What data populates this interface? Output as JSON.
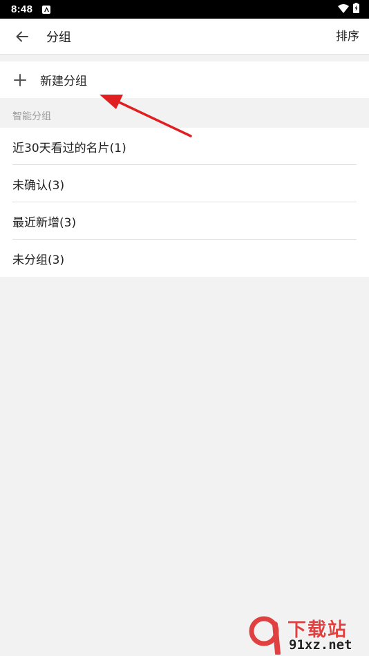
{
  "status_bar": {
    "time": "8:48",
    "icons": [
      "notification-a-icon",
      "wifi-icon",
      "battery-charging-icon"
    ]
  },
  "app_bar": {
    "back_icon": "arrow-left-icon",
    "title": "分组",
    "sort_label": "排序"
  },
  "new_group": {
    "icon": "plus-icon",
    "label": "新建分组"
  },
  "smart_groups": {
    "header": "智能分组",
    "items": [
      {
        "label": "近30天看过的名片(1)"
      },
      {
        "label": "未确认(3)"
      },
      {
        "label": "最近新增(3)"
      },
      {
        "label": "未分组(3)"
      }
    ]
  },
  "annotation": {
    "color": "#e02020"
  },
  "watermark": {
    "title": "下载站",
    "domain": "91xz.net"
  },
  "colors": {
    "background": "#f2f2f2",
    "surface": "#ffffff",
    "text": "#222222",
    "muted": "#9a9a9a",
    "divider": "#dedede",
    "accent_red": "#e02020"
  }
}
